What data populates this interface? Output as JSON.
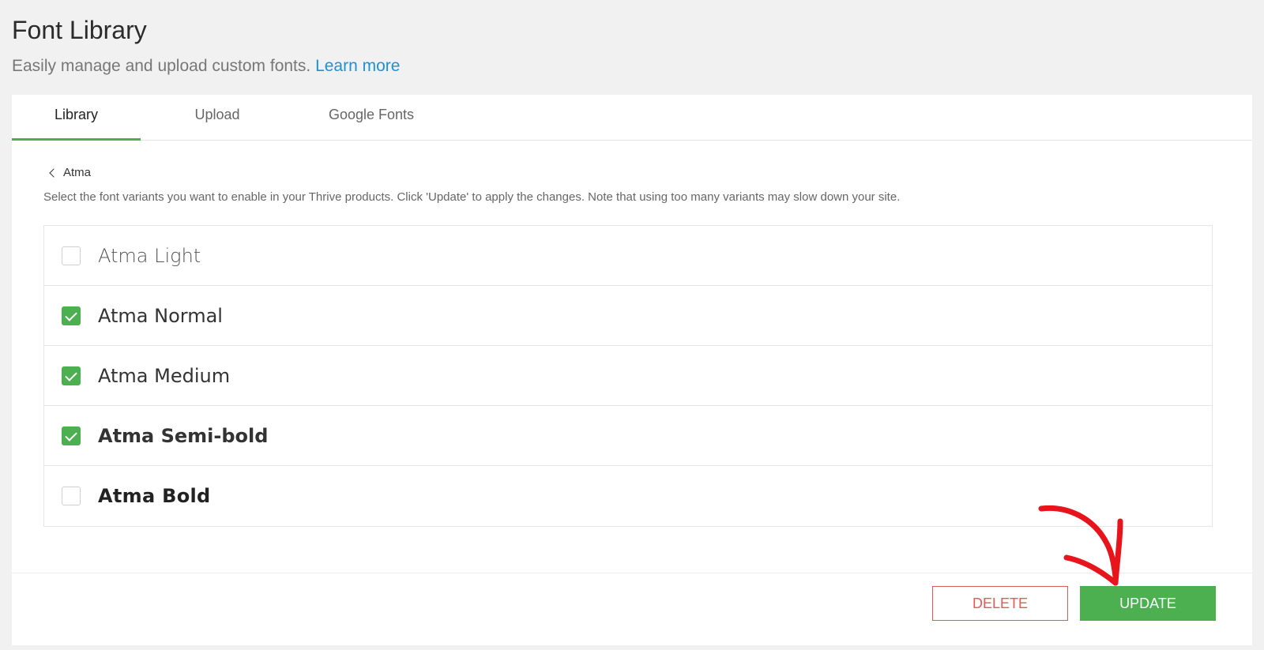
{
  "header": {
    "title": "Font Library",
    "subtitle": "Easily manage and upload custom fonts.",
    "learn_more": "Learn more"
  },
  "tabs": [
    {
      "label": "Library",
      "active": true
    },
    {
      "label": "Upload",
      "active": false
    },
    {
      "label": "Google Fonts",
      "active": false
    }
  ],
  "font_family": {
    "back_label": "Atma",
    "instructions": "Select the font variants you want to enable in your Thrive products. Click 'Update' to apply the changes. Note that using too many variants may slow down your site."
  },
  "variants": [
    {
      "label": "Atma Light",
      "checked": false
    },
    {
      "label": "Atma Normal",
      "checked": true
    },
    {
      "label": "Atma Medium",
      "checked": true
    },
    {
      "label": "Atma Semi-bold",
      "checked": true
    },
    {
      "label": "Atma Bold",
      "checked": false
    }
  ],
  "actions": {
    "delete_label": "DELETE",
    "update_label": "UPDATE"
  },
  "colors": {
    "accent": "#4caf50",
    "danger": "#e05a5a",
    "link": "#1e90d6",
    "annotation": "#e8141b"
  }
}
